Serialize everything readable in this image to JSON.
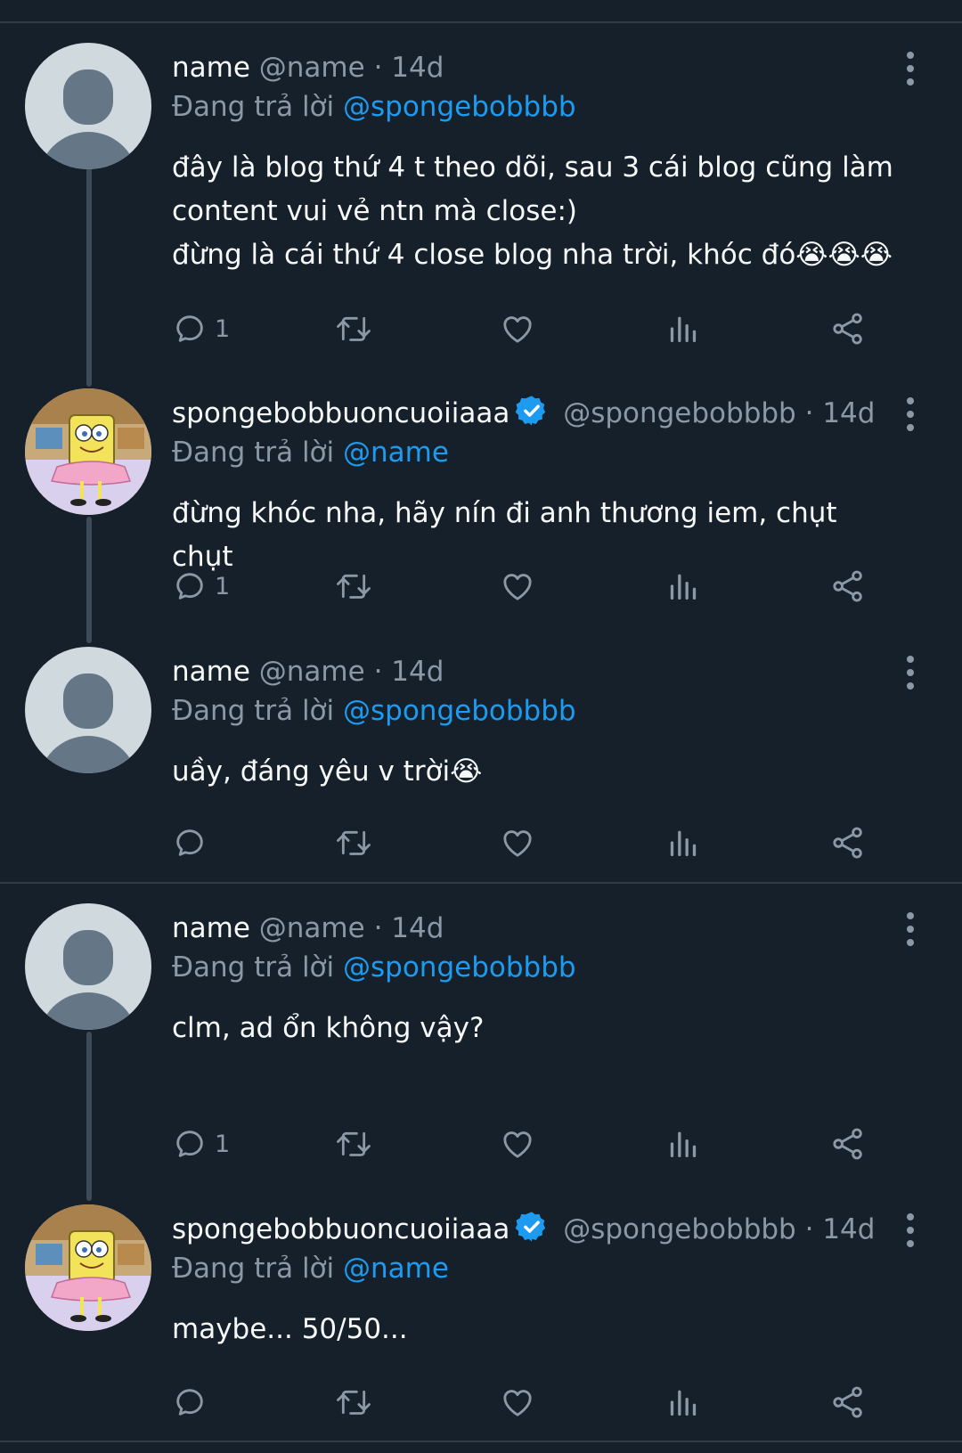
{
  "tweets": [
    {
      "name": "name",
      "handle": "@name",
      "time": "14d",
      "reply_label": "Đang trả lời",
      "reply_to": "@spongebobbbb",
      "text": "đây là blog thứ 4 t theo dõi, sau 3 cái blog cũng làm\ncontent vui vẻ ntn mà close:)\nđừng là cái thứ 4 close blog nha trời, khóc đó😭😭😭",
      "reply_count": "1",
      "avatar": "default-avatar"
    },
    {
      "name": "spongebobbuoncuoiiaaa",
      "handle": "@spongebobbbb",
      "time": "14d",
      "reply_label": "Đang trả lời",
      "reply_to": "@name",
      "text": "đừng khóc nha, hãy nín đi anh thương iem, chụt chụt",
      "reply_count": "1",
      "avatar": "spongebob-avatar"
    },
    {
      "name": "name",
      "handle": "@name",
      "time": "14d",
      "reply_label": "Đang trả lời",
      "reply_to": "@spongebobbbb",
      "text": "uầy, đáng yêu v trời😭",
      "reply_count": "",
      "avatar": "default-avatar"
    },
    {
      "name": "name",
      "handle": "@name",
      "time": "14d",
      "reply_label": "Đang trả lời",
      "reply_to": "@spongebobbbb",
      "text": "clm, ad ổn không vậy?",
      "reply_count": "1",
      "avatar": "default-avatar"
    },
    {
      "name": "spongebobbuoncuoiiaaa",
      "handle": "@spongebobbbb",
      "time": "14d",
      "reply_label": "Đang trả lời",
      "reply_to": "@name",
      "text": "maybe... 50/50...",
      "reply_count": "",
      "avatar": "spongebob-avatar"
    }
  ],
  "separator_dot": "·",
  "colors": {
    "background": "#15202b",
    "text": "#f7f9f9",
    "muted": "#8b98a5",
    "accent": "#1d9bf0"
  },
  "icons": [
    "reply-icon",
    "retweet-icon",
    "like-icon",
    "views-icon",
    "share-icon",
    "more-icon",
    "verified-icon"
  ]
}
